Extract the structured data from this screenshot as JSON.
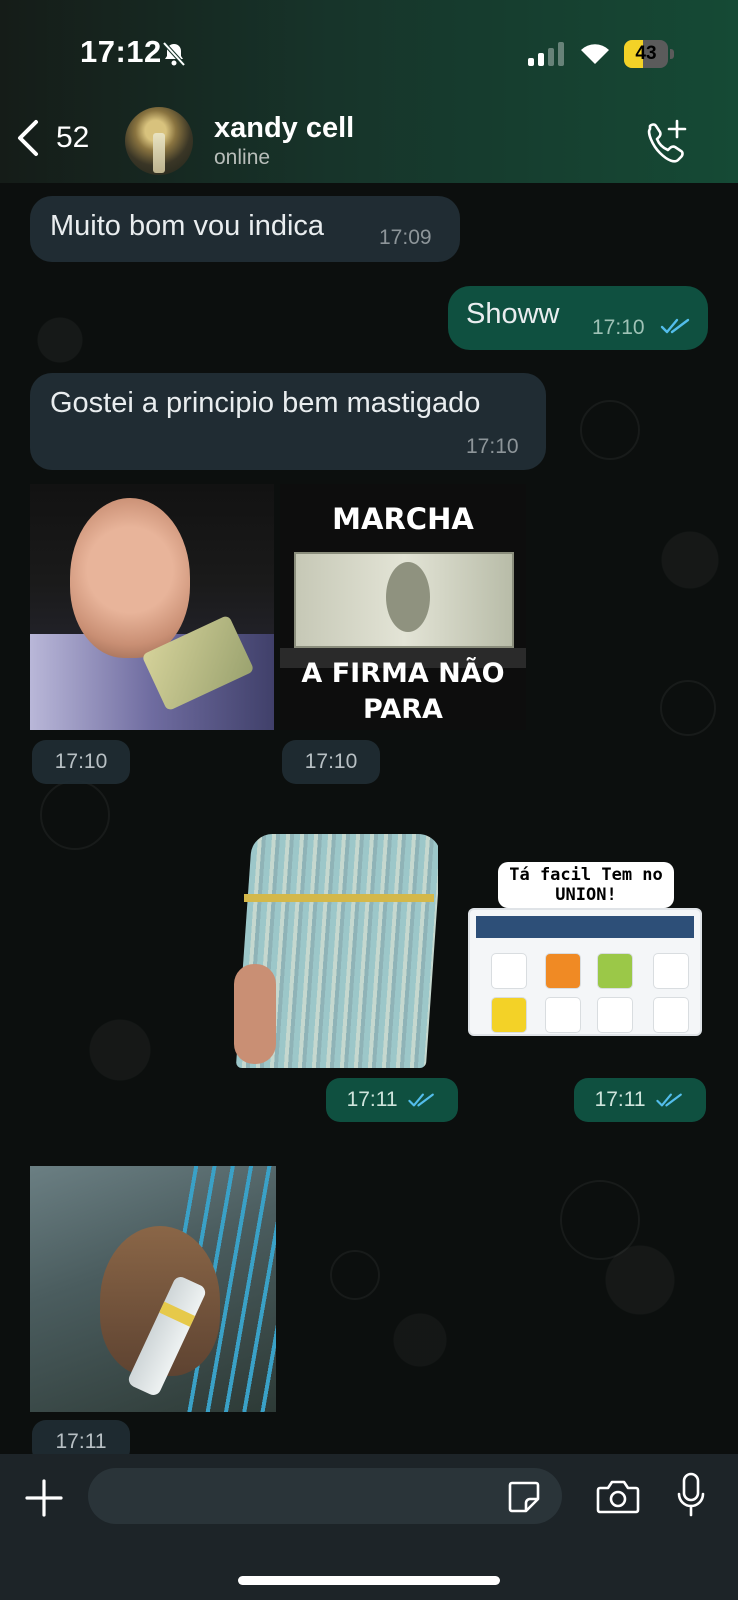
{
  "status_bar": {
    "time": "17:12",
    "battery": "43",
    "battery_level": 0.43,
    "signal_bars": 2
  },
  "header": {
    "back_count": "52",
    "contact_name": "xandy cell",
    "contact_status": "online"
  },
  "messages": [
    {
      "direction": "incoming",
      "type": "text",
      "text": "Muito bom vou indica",
      "time": "17:09"
    },
    {
      "direction": "outgoing",
      "type": "text",
      "text": "Showw",
      "time": "17:10",
      "read": true
    },
    {
      "direction": "incoming",
      "type": "text",
      "text": "Gostei a principio bem mastigado",
      "time": "17:10"
    },
    {
      "direction": "incoming",
      "type": "sticker",
      "time": "17:10"
    },
    {
      "direction": "incoming",
      "type": "sticker",
      "sticker_text_top": "MARCHA",
      "sticker_text_bottom": "A FIRMA NÃO PARA",
      "time": "17:10"
    },
    {
      "direction": "outgoing",
      "type": "sticker",
      "time": "17:11",
      "read": true
    },
    {
      "direction": "outgoing",
      "type": "sticker",
      "sticker_text": "Tá facil Tem no UNION!",
      "time": "17:11",
      "read": true
    },
    {
      "direction": "incoming",
      "type": "sticker",
      "time": "17:11"
    }
  ],
  "composer": {
    "value": ""
  },
  "colors": {
    "incoming_bubble": "#202c33",
    "outgoing_bubble": "#0f5040",
    "read_ticks": "#53bdeb",
    "header_gradient_end": "#154a35"
  },
  "icons": {
    "back": "chevron-left-icon",
    "call": "add-call-icon",
    "attach": "plus-icon",
    "sticker": "sticker-icon",
    "camera": "camera-icon",
    "mic": "microphone-icon",
    "silent": "bell-slash-icon"
  }
}
